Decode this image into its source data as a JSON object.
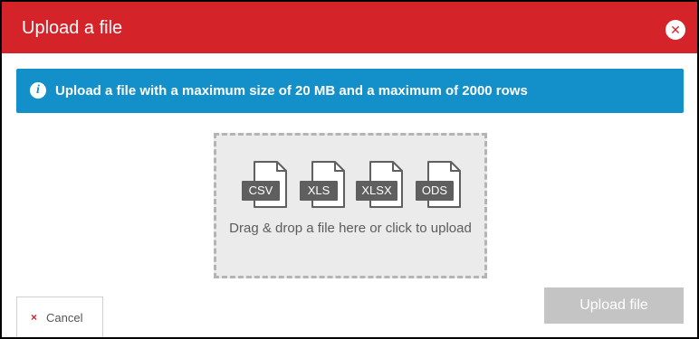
{
  "dialog": {
    "title": "Upload a file",
    "close_icon": "close-icon",
    "accent_color": "#d5232a"
  },
  "info_banner": {
    "icon": "info-icon",
    "icon_glyph": "i",
    "text": "Upload a file with a maximum size of 20 MB and a maximum of 2000 rows",
    "color": "#138fc9"
  },
  "dropzone": {
    "file_types": [
      "CSV",
      "XLS",
      "XLSX",
      "ODS"
    ],
    "instructions": "Drag & drop a file here or click to upload"
  },
  "footer": {
    "cancel_icon": "x-icon",
    "cancel_glyph": "×",
    "cancel_label": "Cancel",
    "upload_label": "Upload file",
    "upload_disabled": true
  }
}
